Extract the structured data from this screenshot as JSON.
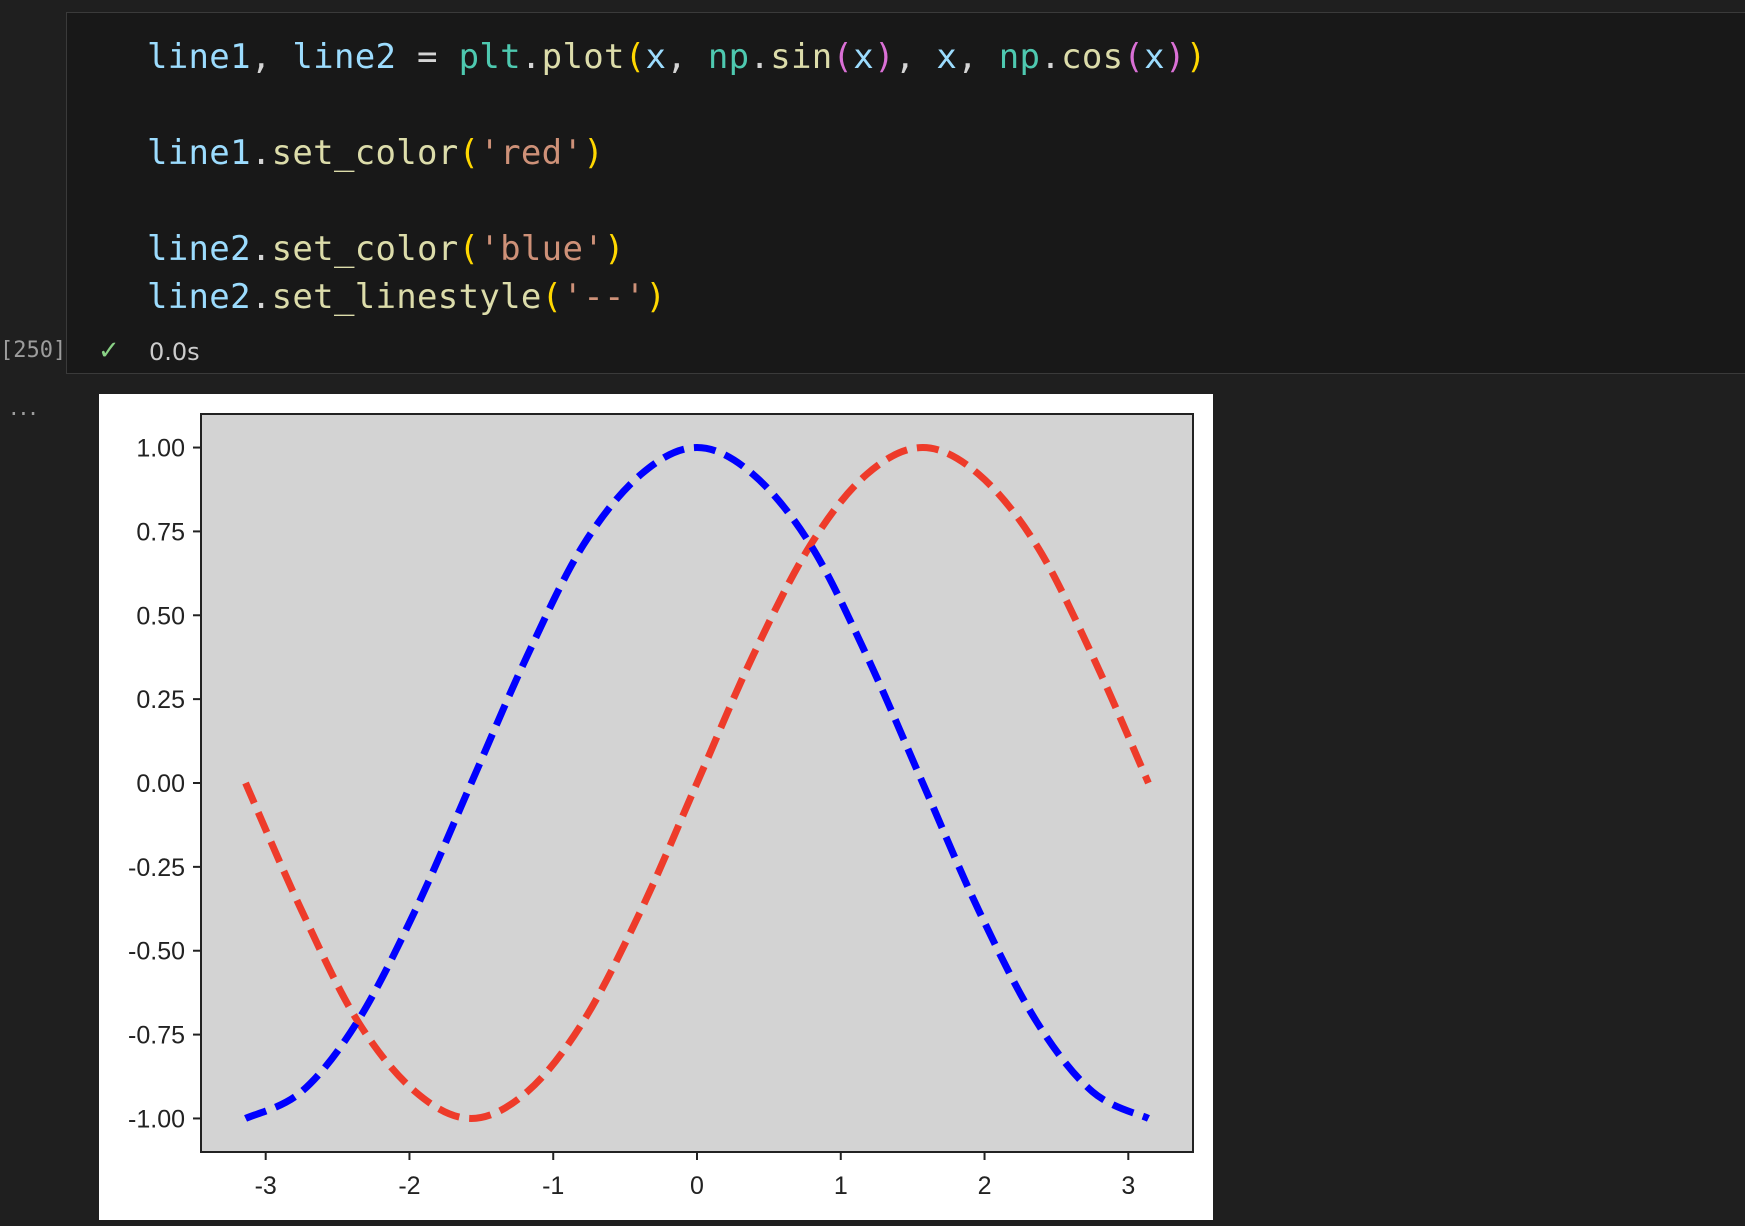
{
  "cell": {
    "execution_count": "[250]",
    "status_icon": "check-icon",
    "duration": "0.0s",
    "more_actions": "...",
    "code_lines": [
      [
        {
          "t": "line1",
          "c": "var"
        },
        {
          "t": ", ",
          "c": "plain"
        },
        {
          "t": "line2",
          "c": "var"
        },
        {
          "t": " = ",
          "c": "plain"
        },
        {
          "t": "plt",
          "c": "mod"
        },
        {
          "t": ".",
          "c": "plain"
        },
        {
          "t": "plot",
          "c": "fn"
        },
        {
          "t": "(",
          "c": "p1"
        },
        {
          "t": "x",
          "c": "var"
        },
        {
          "t": ", ",
          "c": "plain"
        },
        {
          "t": "np",
          "c": "mod"
        },
        {
          "t": ".",
          "c": "plain"
        },
        {
          "t": "sin",
          "c": "fn"
        },
        {
          "t": "(",
          "c": "p2"
        },
        {
          "t": "x",
          "c": "var"
        },
        {
          "t": ")",
          "c": "p2"
        },
        {
          "t": ", ",
          "c": "plain"
        },
        {
          "t": "x",
          "c": "var"
        },
        {
          "t": ", ",
          "c": "plain"
        },
        {
          "t": "np",
          "c": "mod"
        },
        {
          "t": ".",
          "c": "plain"
        },
        {
          "t": "cos",
          "c": "fn"
        },
        {
          "t": "(",
          "c": "p2"
        },
        {
          "t": "x",
          "c": "var"
        },
        {
          "t": ")",
          "c": "p2"
        },
        {
          "t": ")",
          "c": "p1"
        }
      ],
      [],
      [
        {
          "t": "line1",
          "c": "var"
        },
        {
          "t": ".",
          "c": "plain"
        },
        {
          "t": "set_color",
          "c": "fn"
        },
        {
          "t": "(",
          "c": "p1"
        },
        {
          "t": "'red'",
          "c": "str"
        },
        {
          "t": ")",
          "c": "p1"
        }
      ],
      [],
      [
        {
          "t": "line2",
          "c": "var"
        },
        {
          "t": ".",
          "c": "plain"
        },
        {
          "t": "set_color",
          "c": "fn"
        },
        {
          "t": "(",
          "c": "p1"
        },
        {
          "t": "'blue'",
          "c": "str"
        },
        {
          "t": ")",
          "c": "p1"
        }
      ],
      [
        {
          "t": "line2",
          "c": "var"
        },
        {
          "t": ".",
          "c": "plain"
        },
        {
          "t": "set_linestyle",
          "c": "fn"
        },
        {
          "t": "(",
          "c": "p1"
        },
        {
          "t": "'--'",
          "c": "str"
        },
        {
          "t": ")",
          "c": "p1"
        }
      ]
    ]
  },
  "chart_data": {
    "type": "line",
    "title": "",
    "xlabel": "",
    "ylabel": "",
    "xlim": [
      -3.45,
      3.45
    ],
    "ylim": [
      -1.1,
      1.1
    ],
    "xticks": [
      -3,
      -2,
      -1,
      0,
      1,
      2,
      3
    ],
    "xtick_labels": [
      "-3",
      "-2",
      "-1",
      "0",
      "1",
      "2",
      "3"
    ],
    "yticks": [
      1.0,
      0.75,
      0.5,
      0.25,
      0.0,
      -0.25,
      -0.5,
      -0.75,
      -1.0
    ],
    "ytick_labels": [
      "1.00",
      "0.75",
      "0.50",
      "0.25",
      "0.00",
      "-0.25",
      "-0.50",
      "-0.75",
      "-1.00"
    ],
    "grid": false,
    "background": "#d3d3d3",
    "series": [
      {
        "color": "#ee3b2a",
        "linestyle": "dashed",
        "x": [
          -3.14,
          -2.75,
          -2.36,
          -1.96,
          -1.57,
          -1.18,
          -0.79,
          -0.39,
          0.0,
          0.39,
          0.79,
          1.18,
          1.57,
          1.96,
          2.36,
          2.75,
          3.14
        ],
        "y": [
          0.0,
          -0.38,
          -0.71,
          -0.92,
          -1.0,
          -0.92,
          -0.71,
          -0.38,
          0.0,
          0.38,
          0.71,
          0.92,
          1.0,
          0.92,
          0.71,
          0.38,
          0.0
        ]
      },
      {
        "color": "#0000ff",
        "linestyle": "dashed",
        "x": [
          -3.14,
          -2.75,
          -2.36,
          -1.96,
          -1.57,
          -1.18,
          -0.79,
          -0.39,
          0.0,
          0.39,
          0.79,
          1.18,
          1.57,
          1.96,
          2.36,
          2.75,
          3.14
        ],
        "y": [
          -1.0,
          -0.92,
          -0.71,
          -0.38,
          0.0,
          0.38,
          0.71,
          0.92,
          1.0,
          0.92,
          0.71,
          0.38,
          0.0,
          -0.38,
          -0.71,
          -0.92,
          -1.0
        ]
      }
    ]
  }
}
